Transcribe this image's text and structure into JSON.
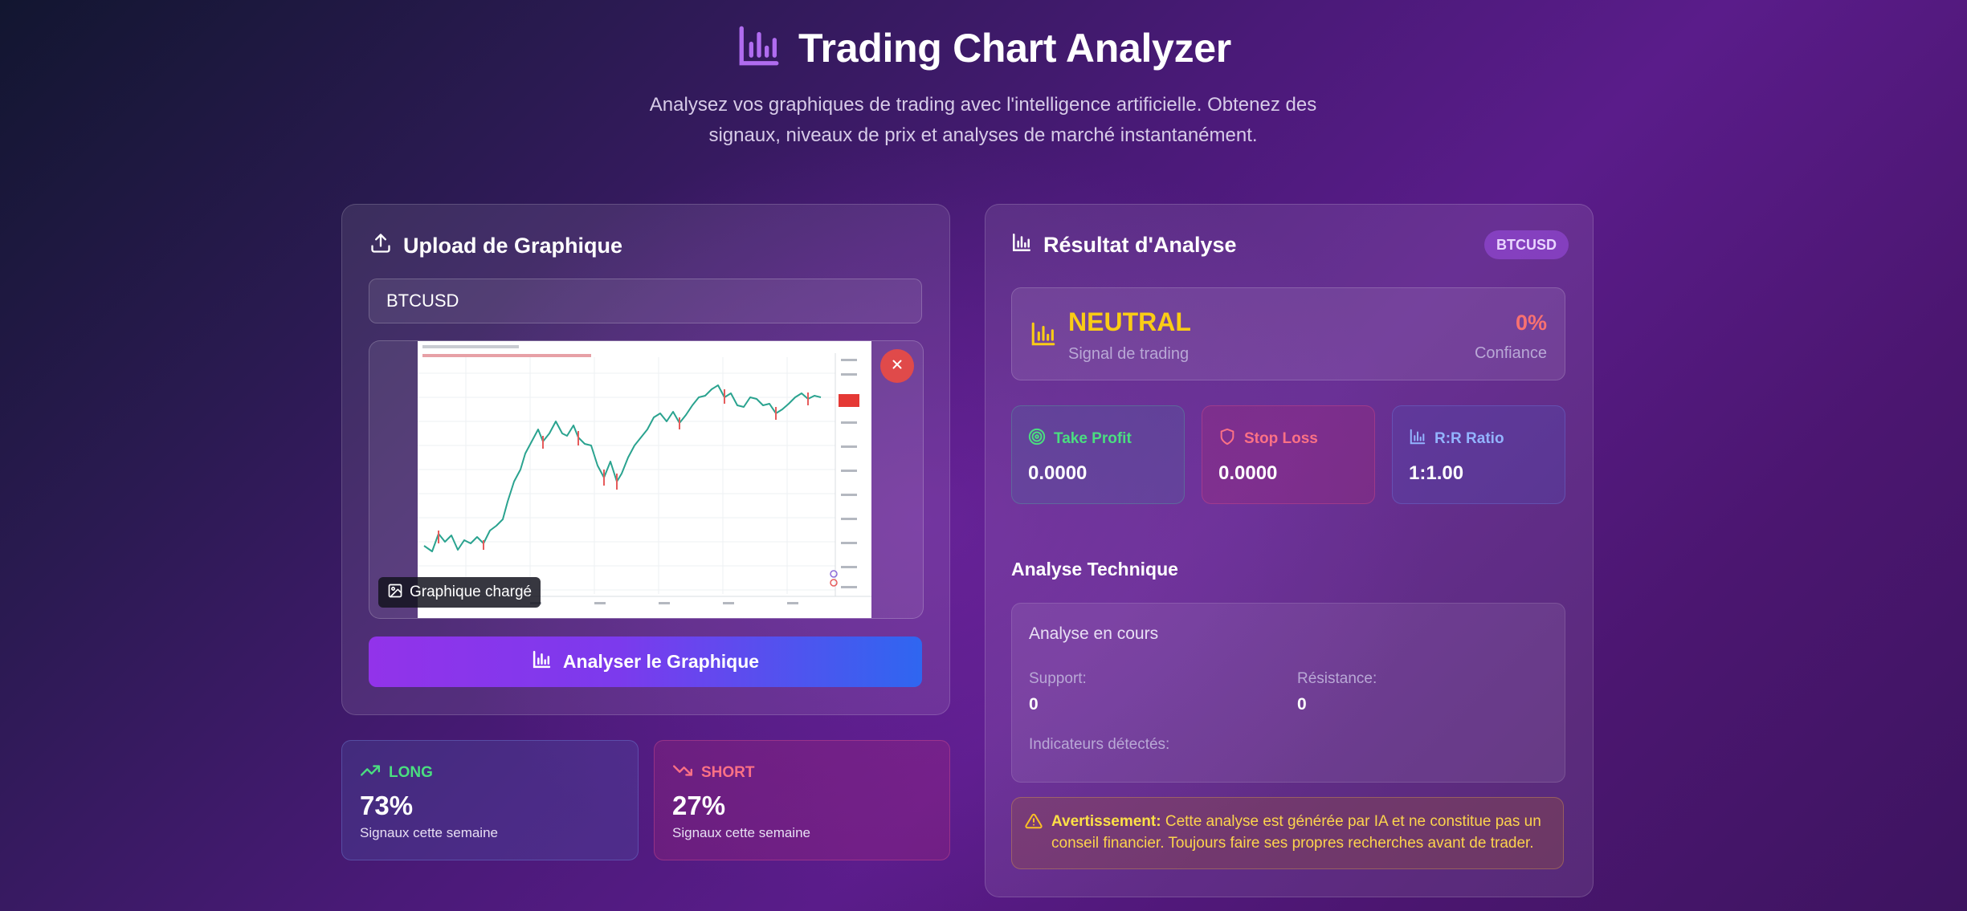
{
  "header": {
    "title": "Trading Chart Analyzer",
    "subtitle": "Analysez vos graphiques de trading avec l'intelligence artificielle. Obtenez des signaux, niveaux de prix et analyses de marché instantanément."
  },
  "upload": {
    "title": "Upload de Graphique",
    "symbol_value": "BTCUSD",
    "badge_label": "Graphique chargé",
    "analyze_label": "Analyser le Graphique"
  },
  "stats": {
    "long": {
      "label": "LONG",
      "value": "73%",
      "caption": "Signaux cette semaine"
    },
    "short": {
      "label": "SHORT",
      "value": "27%",
      "caption": "Signaux cette semaine"
    }
  },
  "result": {
    "title": "Résultat d'Analyse",
    "symbol_badge": "BTCUSD",
    "signal": "NEUTRAL",
    "signal_caption": "Signal de trading",
    "confidence": "0%",
    "confidence_label": "Confiance",
    "take_profit_label": "Take Profit",
    "take_profit_value": "0.0000",
    "stop_loss_label": "Stop Loss",
    "stop_loss_value": "0.0000",
    "rr_label": "R:R Ratio",
    "rr_value": "1:1.00"
  },
  "technical": {
    "title": "Analyse Technique",
    "status": "Analyse en cours",
    "support_label": "Support:",
    "support_value": "0",
    "resistance_label": "Résistance:",
    "resistance_value": "0",
    "indicators_label": "Indicateurs détectés:"
  },
  "warning": {
    "strong": "Avertissement:",
    "text": " Cette analyse est générée par IA et ne constitue pas un conseil financier. Toujours faire ses propres recherches avant de trader."
  },
  "colors": {
    "accent_purple": "#9233ea",
    "accent_blue": "#2f66f0",
    "neutral_yellow": "#facc15",
    "confidence_red": "#f87171",
    "long_green": "#4ade80",
    "short_pink": "#fb7185",
    "rr_blue": "#93b4ff"
  }
}
